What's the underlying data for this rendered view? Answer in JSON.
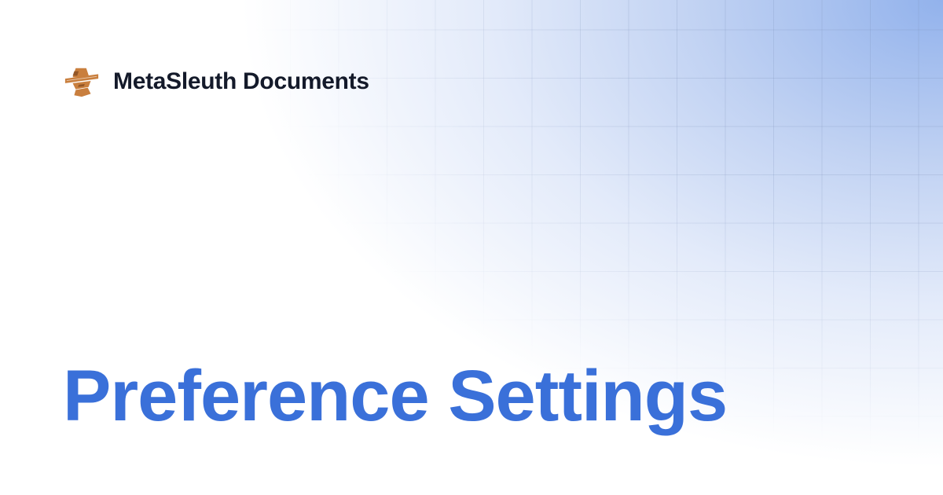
{
  "brand": {
    "name": "MetaSleuth Documents",
    "logo_icon": "detective-hat-icon",
    "logo_color": "#c97f3e"
  },
  "page": {
    "title": "Preference Settings",
    "title_color": "#3a70d9",
    "accent_background": "#9ab5ec"
  },
  "decor": {
    "grid_icon": "background-grid"
  }
}
